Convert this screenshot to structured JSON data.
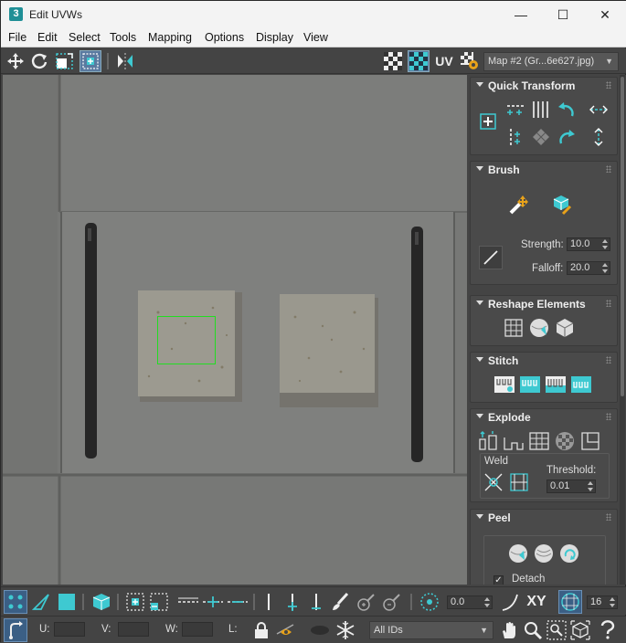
{
  "window": {
    "title": "Edit UVWs",
    "app_icon_text": "3",
    "controls": {
      "minimize": "—",
      "maximize": "☐",
      "close": "✕"
    }
  },
  "menu": {
    "items": [
      "File",
      "Edit",
      "Select",
      "Tools",
      "Mapping",
      "Options",
      "Display",
      "View"
    ]
  },
  "toolbar": {
    "uv_label": "UV",
    "map_dropdown": "Map #2 (Gr...6e627.jpg)"
  },
  "panel": {
    "quick_transform": {
      "title": "Quick Transform"
    },
    "brush": {
      "title": "Brush",
      "strength_label": "Strength:",
      "strength_value": "10.0",
      "falloff_label": "Falloff:",
      "falloff_value": "20.0"
    },
    "reshape": {
      "title": "Reshape Elements"
    },
    "stitch": {
      "title": "Stitch"
    },
    "explode": {
      "title": "Explode",
      "weld_label": "Weld",
      "threshold_label": "Threshold:",
      "threshold_value": "0.01"
    },
    "peel": {
      "title": "Peel",
      "detach_label": "Detach"
    }
  },
  "bottom": {
    "angle_value": "0.0",
    "xy_label": "XY",
    "grid_value": "16",
    "u_label": "U:",
    "v_label": "V:",
    "w_label": "W:",
    "l_label": "L:",
    "ids_dropdown": "All IDs"
  },
  "colors": {
    "accent": "#3ec9d1",
    "selection_box": "#22dd22",
    "panel_bg": "#444444"
  }
}
